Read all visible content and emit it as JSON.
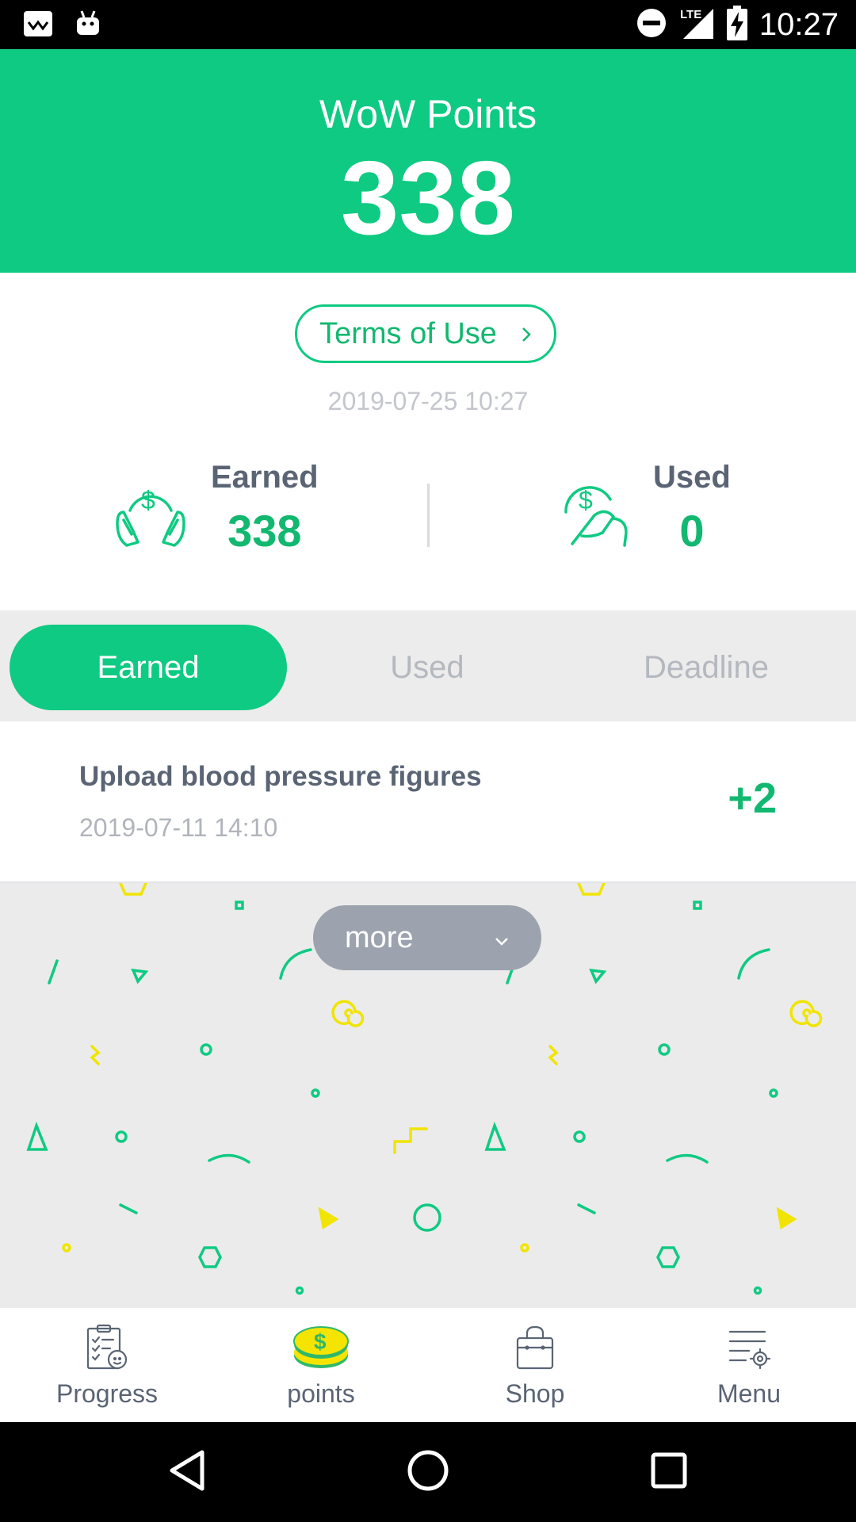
{
  "status_bar": {
    "time": "10:27",
    "network": "LTE"
  },
  "header": {
    "title": "WoW Points",
    "points": "338",
    "background": "#0fca82"
  },
  "terms": {
    "label": "Terms of Use"
  },
  "timestamp": "2019-07-25 10:27",
  "summary": {
    "earned_label": "Earned",
    "earned_value": "338",
    "used_label": "Used",
    "used_value": "0"
  },
  "tabs": [
    {
      "label": "Earned",
      "active": true
    },
    {
      "label": "Used",
      "active": false
    },
    {
      "label": "Deadline",
      "active": false
    }
  ],
  "history": [
    {
      "title": "Upload blood pressure figures",
      "date": "2019-07-11 14:10",
      "points": "+2"
    }
  ],
  "more": {
    "label": "more"
  },
  "bottom_nav": [
    {
      "label": "Progress",
      "icon": "progress-icon"
    },
    {
      "label": "points",
      "icon": "coin-icon"
    },
    {
      "label": "Shop",
      "icon": "shopping-bag-icon"
    },
    {
      "label": "Menu",
      "icon": "menu-settings-icon"
    }
  ],
  "colors": {
    "accent": "#0fca82",
    "accent_text": "#12b86f",
    "text_dark": "#5a6474",
    "muted": "#b4b8bf"
  }
}
